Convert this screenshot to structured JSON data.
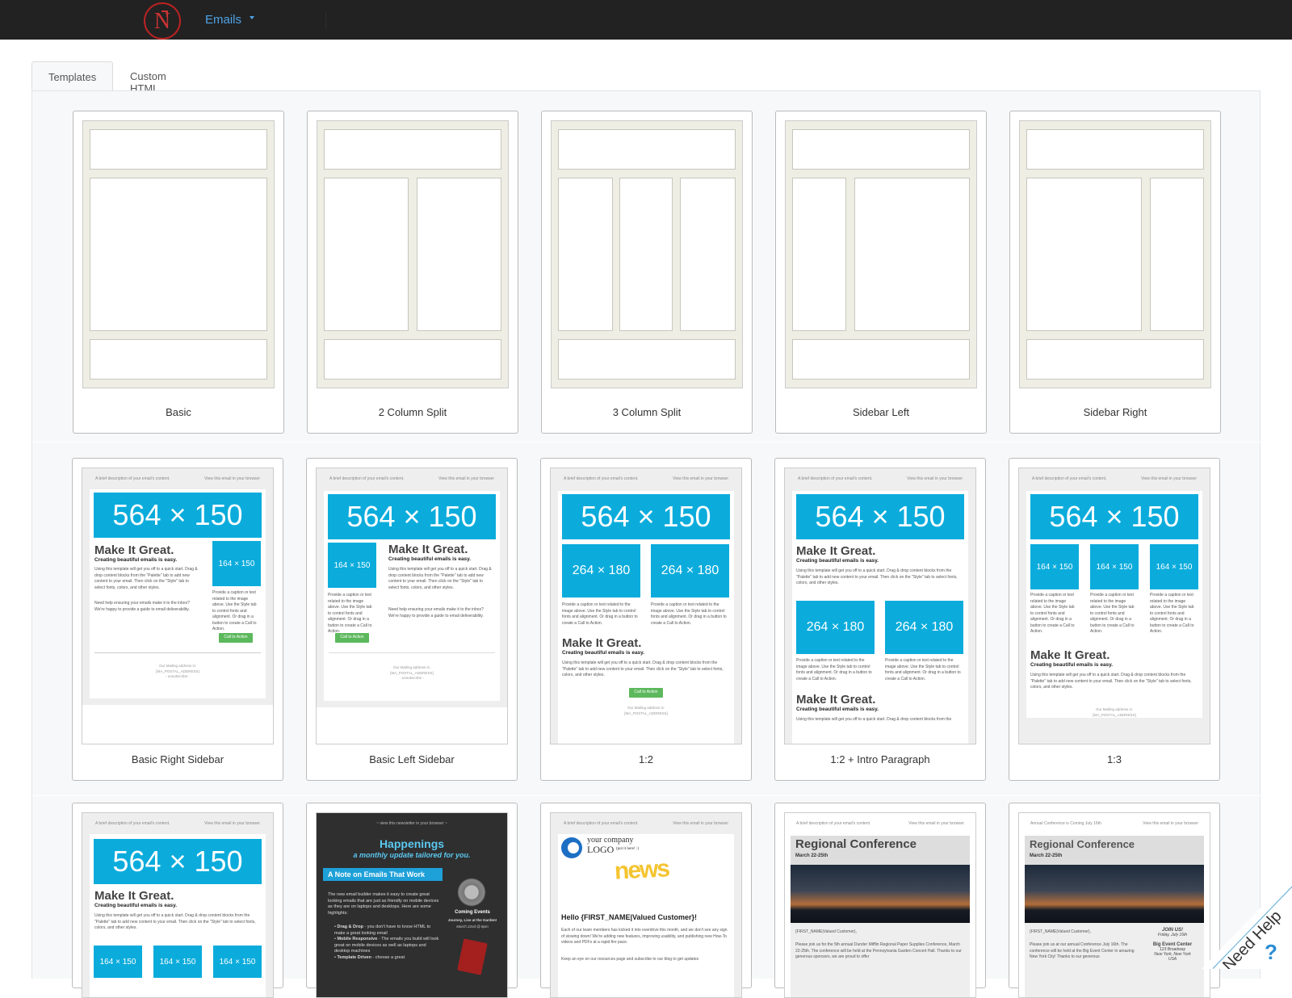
{
  "app": {
    "menu_label": "Emails",
    "logo_letter": "N"
  },
  "tabs": [
    {
      "label": "Templates"
    },
    {
      "label": "Custom HTML"
    }
  ],
  "row1": [
    {
      "label": "Basic"
    },
    {
      "label": "2 Column Split"
    },
    {
      "label": "3 Column Split"
    },
    {
      "label": "Sidebar Left"
    },
    {
      "label": "Sidebar Right"
    }
  ],
  "row2": [
    {
      "label": "Basic Right Sidebar"
    },
    {
      "label": "Basic Left Sidebar"
    },
    {
      "label": "1:2"
    },
    {
      "label": "1:2 + Intro Paragraph"
    },
    {
      "label": "1:3"
    }
  ],
  "preview": {
    "preheader_left": "A brief description of your email's content.",
    "preheader_right": "View this email in your browser",
    "hero": "564 × 150",
    "small_img": "164 × 150",
    "mid_img": "264 × 180",
    "headline": "Make It Great.",
    "subhead": "Creating beautiful emails is easy.",
    "body_text": "Using this template will get you off to a quick start. Drag & drop content blocks from the \"Palette\" tab to add new content to your email. Then click on the \"Style\" tab to select fonts, colors, and other styles.",
    "body_text2": "Need help ensuring your emails make it to the inbox? We're happy to provide a guide to email deliverability.",
    "caption": "Provide a caption or text related to the image above. Use the Style tab to control fonts and alignment. Or drag in a button to create a Call to Action.",
    "cta": "Call to Action",
    "footer1": "Our Mailing address is:",
    "footer2": "[MA_POSTAL_ADDRESS]",
    "footer3": "- unsubscribe -"
  },
  "row3": {
    "happenings": {
      "preheader": "~ view this newsletter in your browser ~",
      "title": "Happenings",
      "tagline": "a monthly update tailored for you.",
      "note": "A Note on Emails That Work",
      "intro": "The new email builder makes it easy to create great looking emails that are just as friendly on mobile devices as they are on laptops and desktops. Here are some highlights:",
      "b1": "Drag & Drop",
      "b1t": " - you don't have to know HTML to make a great looking email",
      "b2": "Mobile Responsive",
      "b2t": " - The emails you build will look great on mobile devices as well as laptops and desktop machines",
      "b3": "Template Driven",
      "b3t": " - choose a great",
      "side_title": "Coming Events",
      "side_sub": "Journey, Live at the Garden!",
      "side_date": "March 22nd @ 8pm"
    },
    "news": {
      "logo1": "your company",
      "logo2": "LOGO",
      "logo3": "(put it here! :)",
      "word": "news",
      "hello": "Hello {FIRST_NAME|Valued Customer}!",
      "p1": "Each of our team members has kicked it into overdrive this month, and we don't see any sign of slowing down! We're adding new features, improving usability, and publishing new How-To videos and PDFs at a rapid fire pace.",
      "p2": "Keep an eye on our resources page and subscribe to our blog to get updates"
    },
    "conf1": {
      "preheader": "A brief description of your email's content",
      "view": "View this email in your browser",
      "title": "Regional Conference",
      "date": "March 22-25th",
      "greet": "{FIRST_NAME|Valued Customer},",
      "p": "Please join us for the 5th annual Dunder Mifflin Regional Paper Supplies Conference, March 22-25th. The conference will be held at the Pennsylvania Garden Concert Hall. Thanks to our generous sponsors, we are proud to offer"
    },
    "conf2": {
      "preheader": "Annual Conference is Coming July 16th",
      "view": "View this email in your browser",
      "title": "Regional Conference",
      "date": "March 22-25th",
      "greet": "{FIRST_NAME|Valued Customer},",
      "p": "Please join us at our annual Conference July 16th. The conference will be held at the Big Event Center in amazing New York City! Thanks to our generous",
      "join": "JOIN US!",
      "join_date": "Friday, July 16th",
      "venue": "Big Event Center",
      "addr1": "123 Broadway",
      "addr2": "New York, New York",
      "addr3": "USA"
    }
  },
  "help": {
    "label": "Need Help",
    "icon": "?"
  },
  "colors": {
    "accent": "#0bacdc",
    "topbar": "#222222",
    "cta": "#5cb85c",
    "logo": "#cc3333"
  }
}
